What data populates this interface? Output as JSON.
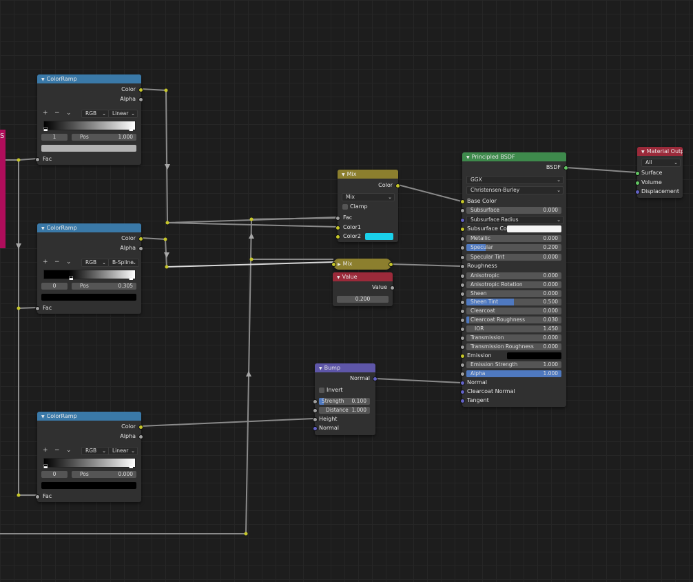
{
  "offscreen_node": {
    "label_fragment": "S"
  },
  "colorramp1": {
    "title": "ColorRamp",
    "outputs": {
      "color": "Color",
      "alpha": "Alpha"
    },
    "tools": {
      "add": "+",
      "remove": "−",
      "menu": "⌄"
    },
    "color_mode": "RGB",
    "interpolation": "Linear",
    "stop_index": "1",
    "pos_label": "Pos",
    "pos_value": "1.000",
    "selected_color": "#b3b3b3",
    "input": "Fac"
  },
  "colorramp2": {
    "title": "ColorRamp",
    "outputs": {
      "color": "Color",
      "alpha": "Alpha"
    },
    "tools": {
      "add": "+",
      "remove": "−",
      "menu": "⌄"
    },
    "color_mode": "RGB",
    "interpolation": "B-Spline",
    "stop_index": "0",
    "pos_label": "Pos",
    "pos_value": "0.305",
    "selected_color": "#000000",
    "input": "Fac"
  },
  "colorramp3": {
    "title": "ColorRamp",
    "outputs": {
      "color": "Color",
      "alpha": "Alpha"
    },
    "tools": {
      "add": "+",
      "remove": "−",
      "menu": "⌄"
    },
    "color_mode": "RGB",
    "interpolation": "Linear",
    "stop_index": "0",
    "pos_label": "Pos",
    "pos_value": "0.000",
    "selected_color": "#000000",
    "input": "Fac"
  },
  "mix_node": {
    "title": "Mix",
    "output": "Color",
    "blend_type": "Mix",
    "clamp_label": "Clamp",
    "clamp_checked": false,
    "inputs": {
      "fac": "Fac",
      "color1": "Color1",
      "color2": "Color2"
    },
    "color2_value": "#1ad1ea"
  },
  "mix_collapsed": {
    "title": "Mix"
  },
  "value_node": {
    "title": "Value",
    "output": "Value",
    "value": "0.200"
  },
  "bump_node": {
    "title": "Bump",
    "output": "Normal",
    "invert_label": "Invert",
    "invert_checked": false,
    "strength_label": "Strength",
    "strength_value": "0.100",
    "strength_fraction": 0.1,
    "distance_label": "Distance",
    "distance_value": "1.000",
    "inputs": {
      "height": "Height",
      "normal": "Normal"
    }
  },
  "principled": {
    "title": "Principled BSDF",
    "output": "BSDF",
    "distribution": "GGX",
    "subsurface_method": "Christensen-Burley",
    "base_color_label": "Base Color",
    "subsurface": {
      "label": "Subsurface",
      "value": "0.000"
    },
    "subsurface_radius": "Subsurface Radius",
    "subsurface_color_label": "Subsurface Co...",
    "subsurface_color": "#f5f5f5",
    "metallic": {
      "label": "Metallic",
      "value": "0.000"
    },
    "specular": {
      "label": "Specular",
      "value": "0.200",
      "fraction": 0.2
    },
    "specular_tint": {
      "label": "Specular Tint",
      "value": "0.000"
    },
    "roughness_label": "Roughness",
    "anisotropic": {
      "label": "Anisotropic",
      "value": "0.000"
    },
    "anisotropic_rotation": {
      "label": "Anisotropic Rotation",
      "value": "0.000"
    },
    "sheen": {
      "label": "Sheen",
      "value": "0.000"
    },
    "sheen_tint": {
      "label": "Sheen Tint",
      "value": "0.500",
      "fraction": 0.5
    },
    "clearcoat": {
      "label": "Clearcoat",
      "value": "0.000"
    },
    "clearcoat_roughness": {
      "label": "Clearcoat Roughness",
      "value": "0.030",
      "fraction": 0.03
    },
    "ior": {
      "label": "IOR",
      "value": "1.450"
    },
    "transmission": {
      "label": "Transmission",
      "value": "0.000"
    },
    "transmission_roughness": {
      "label": "Transmission Roughness",
      "value": "0.000"
    },
    "emission_label": "Emission",
    "emission_color": "#000000",
    "emission_strength": {
      "label": "Emission Strength",
      "value": "1.000"
    },
    "alpha": {
      "label": "Alpha",
      "value": "1.000",
      "fraction": 1.0
    },
    "normal_label": "Normal",
    "clearcoat_normal_label": "Clearcoat Normal",
    "tangent_label": "Tangent"
  },
  "material_output": {
    "title": "Material Outpu",
    "target": "All",
    "inputs": {
      "surface": "Surface",
      "volume": "Volume",
      "displacement": "Displacement"
    }
  },
  "colors": {
    "wire": "#8a8a8a",
    "wire_active": "#d9d9d9",
    "socket_color": "#c7c729",
    "socket_float": "#a1a1a1",
    "socket_vector": "#6363c7",
    "socket_shader": "#63c763"
  }
}
